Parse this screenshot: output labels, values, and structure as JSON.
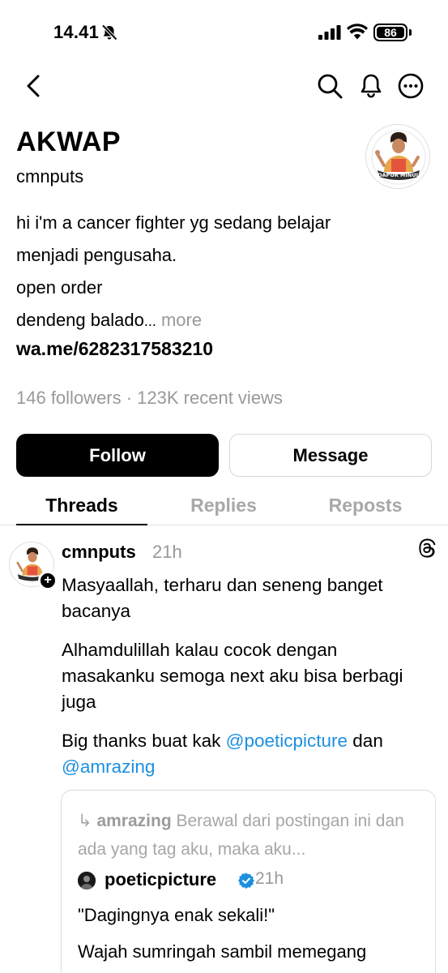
{
  "status_bar": {
    "time": "14.41",
    "battery": "86",
    "battery_level": 0.86,
    "icons": [
      "bell-slash-icon",
      "cellular-signal-icon",
      "wifi-icon",
      "battery-icon"
    ]
  },
  "nav": {
    "icons": [
      "back-chevron-icon",
      "search-icon",
      "notification-bell-icon",
      "more-options-icon"
    ]
  },
  "profile": {
    "display_name": "AKWAP",
    "username": "cmnputs",
    "avatar_caption": "DAPUR MINUL",
    "bio_lines": [
      "hi i'm a cancer fighter yg sedang belajar",
      "menjadi pengusaha.",
      "open order",
      "dendeng balado"
    ],
    "bio_ellipsis": "...",
    "bio_more": " more",
    "link": "wa.me/6282317583210",
    "stats": "146 followers · 123K recent views"
  },
  "actions": {
    "follow": "Follow",
    "message": "Message"
  },
  "tabs": [
    {
      "label": "Threads",
      "active": true
    },
    {
      "label": "Replies",
      "active": false
    },
    {
      "label": "Reposts",
      "active": false
    }
  ],
  "post": {
    "username": "cmnputs",
    "time": "21h",
    "paragraph1": "Masyaallah, terharu dan seneng banget bacanya",
    "paragraph2": "Alhamdulillah kalau cocok dengan masakanku semoga next aku bisa berbagi juga",
    "paragraph3_prefix": "Big thanks buat kak ",
    "mention1": "@poeticpicture",
    "paragraph3_mid": " dan ",
    "mention2": "@amrazing",
    "quote": {
      "reply_arrow": "↳",
      "reply_user": "amrazing",
      "reply_text": " Berawal dari postingan ini dan ada yang tag aku, maka aku...",
      "user": "poeticpicture",
      "time": "21h",
      "text1": "\"Dagingnya enak sekali!\"",
      "text2": "Wajah sumringah sambil memegang"
    }
  },
  "colors": {
    "accent_blue": "#1d8fe0",
    "muted": "#999999",
    "follow_bg": "#000000"
  }
}
